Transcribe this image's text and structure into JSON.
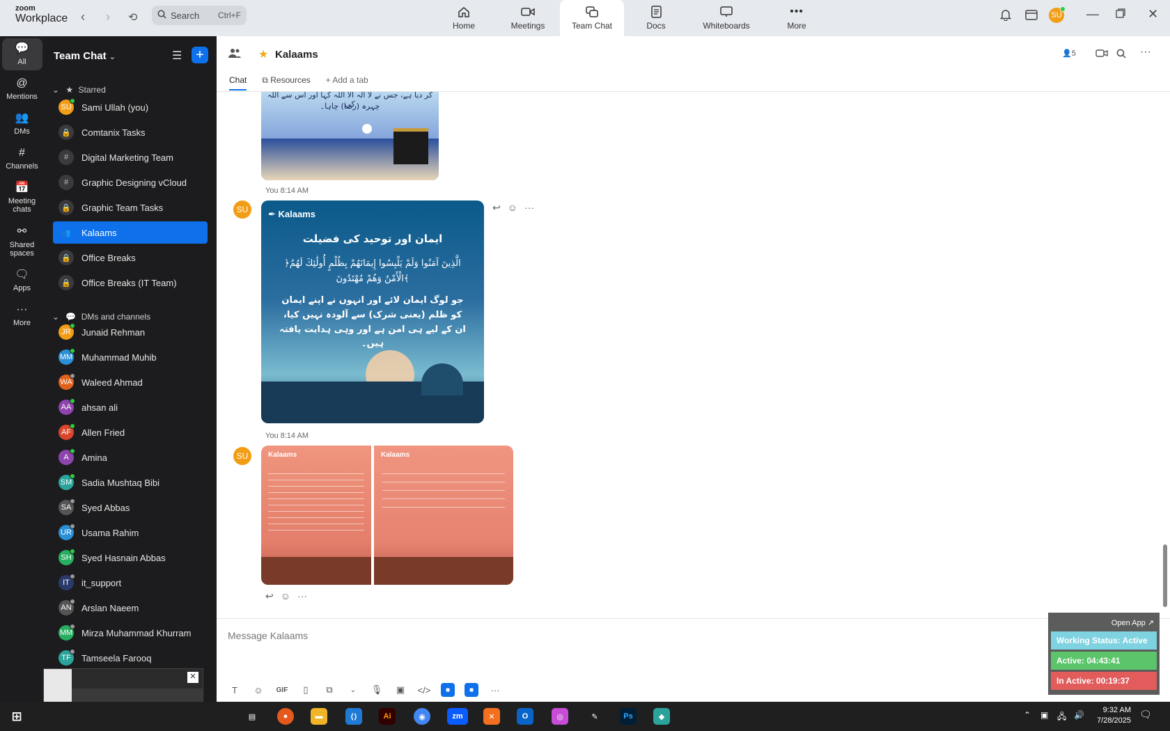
{
  "topbar": {
    "logo_line1": "zoom",
    "logo_line2": "Workplace",
    "search_label": "Search",
    "search_shortcut": "Ctrl+F",
    "tabs": [
      {
        "label": "Home",
        "icon": "home-icon"
      },
      {
        "label": "Meetings",
        "icon": "video-icon"
      },
      {
        "label": "Team Chat",
        "icon": "chat-icon",
        "active": true
      },
      {
        "label": "Docs",
        "icon": "doc-icon"
      },
      {
        "label": "Whiteboards",
        "icon": "whiteboard-icon"
      },
      {
        "label": "More",
        "icon": "more-icon"
      }
    ],
    "user_initials": "SU"
  },
  "rail": [
    {
      "label": "All",
      "active": true
    },
    {
      "label": "Mentions"
    },
    {
      "label": "DMs"
    },
    {
      "label": "Channels"
    },
    {
      "label": "Meeting chats"
    },
    {
      "label": "Shared spaces"
    },
    {
      "label": "Apps"
    },
    {
      "label": "More"
    }
  ],
  "sidebar": {
    "title": "Team Chat",
    "starred_header": "Starred",
    "dms_header": "DMs and channels",
    "starred": [
      {
        "label": "Sami Ullah (you)",
        "initials": "SU",
        "color": "#f29d16",
        "status": "#2ecc40"
      },
      {
        "label": "Comtanix Tasks",
        "kind": "lock"
      },
      {
        "label": "Digital Marketing Team",
        "kind": "hash"
      },
      {
        "label": "Graphic Designing vCloud",
        "kind": "hash"
      },
      {
        "label": "Graphic Team Tasks",
        "kind": "lock"
      },
      {
        "label": "Kalaams",
        "kind": "group",
        "active": true
      },
      {
        "label": "Office Breaks",
        "kind": "lock"
      },
      {
        "label": "Office Breaks (IT Team)",
        "kind": "lock"
      }
    ],
    "dms": [
      {
        "label": "Junaid Rehman",
        "initials": "JR",
        "color": "#f29d16",
        "status": "#2ecc40"
      },
      {
        "label": "Muhammad Muhib",
        "initials": "MM",
        "color": "#2b8fd6",
        "status": "#2ecc40"
      },
      {
        "label": "Waleed Ahmad",
        "initials": "WA",
        "color": "#e0611b",
        "status": "#999999"
      },
      {
        "label": "ahsan ali",
        "initials": "AA",
        "color": "#8e44ad",
        "status": "#2ecc40"
      },
      {
        "label": "Allen Fried",
        "initials": "AF",
        "color": "#d9462c",
        "status": "#2ecc40"
      },
      {
        "label": "Amina",
        "initials": "A",
        "color": "#8e44ad",
        "status": "#2ecc40"
      },
      {
        "label": "Sadia Mushtaq Bibi",
        "initials": "SM",
        "color": "#2aa39b",
        "status": "#2ecc40"
      },
      {
        "label": "Syed Abbas",
        "initials": "SA",
        "color": "#555555",
        "status": "#999999"
      },
      {
        "label": "Usama Rahim",
        "initials": "UR",
        "color": "#2b8fd6",
        "status": "#999999"
      },
      {
        "label": "Syed Hasnain Abbas",
        "initials": "SH",
        "color": "#27ae60",
        "status": "#2ecc40"
      },
      {
        "label": "it_support",
        "initials": "IT",
        "color": "#2a3a6a",
        "status": "#999999"
      },
      {
        "label": "Arslan Naeem",
        "initials": "AN",
        "color": "#555555",
        "status": "#999999"
      },
      {
        "label": "Mirza Muhammad Khurram",
        "initials": "MM",
        "color": "#27ae60",
        "status": "#999999"
      },
      {
        "label": "Tamseela Farooq",
        "initials": "TF",
        "color": "#2aa39b",
        "status": "#999999"
      }
    ]
  },
  "channel": {
    "name": "Kalaams",
    "member_count": "5",
    "tabs": [
      "Chat",
      "Resources",
      "Add a tab"
    ]
  },
  "messages": [
    {
      "time": "You 8:14 AM",
      "author_initials": "SU"
    },
    {
      "time": "You 8:14 AM",
      "author_initials": "SU"
    }
  ],
  "image_text": {
    "img1_line1": "کر دیا ہے، جس نے لا الٰہ الا اللہ کہا اور اس سے اللہ کی",
    "img1_line2": "چہرہ (رضا) چاہا۔",
    "img2_brand": "Kalaams",
    "img2_heading": "ایمان اور توحید کی فضیلت",
    "img2_arabic": "﴿الَّذِينَ آمَنُوا وَلَمْ يَلْبِسُوا إِيمَانَهُمْ بِظُلْمٍ أُولَٰئِكَ لَهُمُ الْأَمْنُ وَهُمْ مُهْتَدُونَ﴾",
    "img2_urdu": "جو لوگ ایمان لائے اور انہوں نے اپنے ایمان کو ظلم (یعنی شرک) سے آلودہ نہیں کیا، ان کے لیے ہی امن ہے اور وہی ہدایت یافتہ ہیں۔",
    "img3_brand": "Kalaams",
    "img4_brand": "Kalaams"
  },
  "composer": {
    "placeholder": "Message Kalaams"
  },
  "widget": {
    "open_label": "Open App ↗",
    "status": "Working Status: Active",
    "active": "Active: 04:43:41",
    "inactive": "In Active: 00:19:37",
    "colors": {
      "status": "#7fd3e0",
      "active": "#5cc46a",
      "inactive": "#e25c5c"
    }
  },
  "taskbar": {
    "time": "9:32 AM",
    "date": "7/28/2025"
  }
}
